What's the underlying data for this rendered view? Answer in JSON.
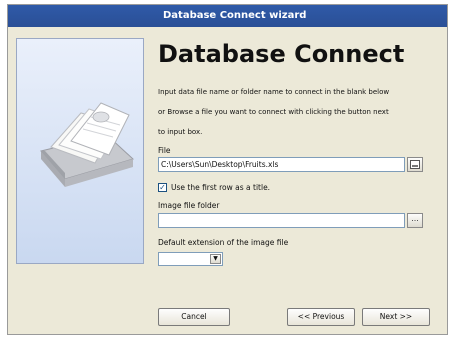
{
  "window": {
    "title": "Database Connect wizard"
  },
  "heading": "Database Connect",
  "description": [
    "Input data file name or folder name to connect in the blank below",
    "or Browse a file you want to connect with clicking the button next",
    "to input box."
  ],
  "file": {
    "label": "File",
    "value": "C:\\Users\\Sun\\Desktop\\Fruits.xls"
  },
  "first_row_title": {
    "checked": true,
    "label": "Use the first row as a title."
  },
  "image_folder": {
    "label": "Image file folder",
    "value": "",
    "browse": "..."
  },
  "image_extension": {
    "label": "Default extension of the image file",
    "value": ""
  },
  "buttons": {
    "cancel": "Cancel",
    "previous": "<< Previous",
    "next": "Next >>"
  }
}
